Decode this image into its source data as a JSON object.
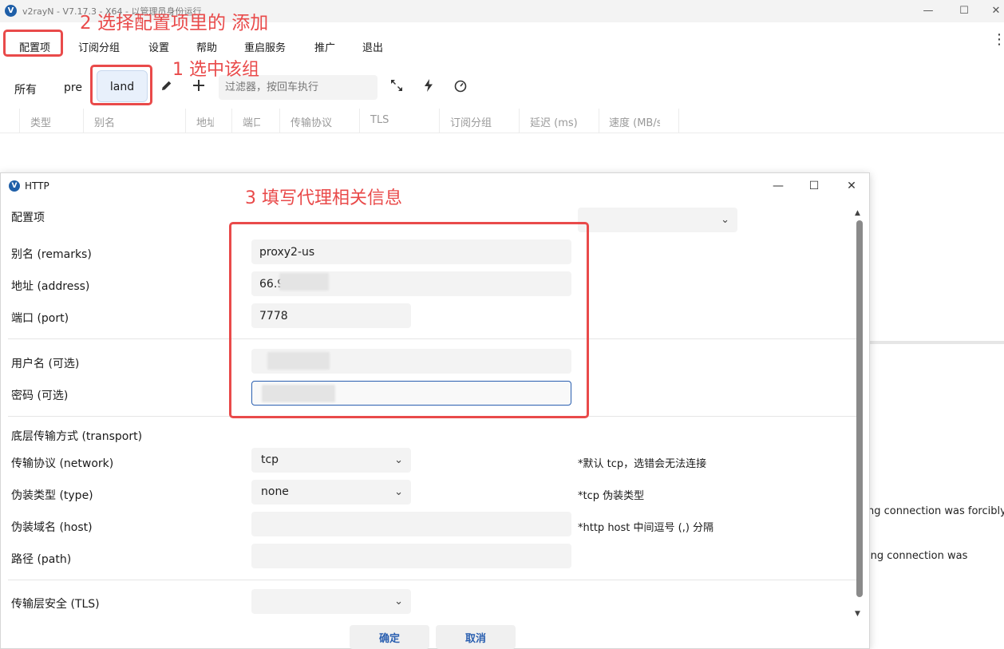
{
  "window": {
    "title": "v2rayN - V7.17.3 - X64 - 以管理员身份运行",
    "controls": {
      "minimize": "—",
      "maximize": "☐",
      "close": "✕"
    }
  },
  "menu": {
    "items": [
      "配置项",
      "订阅分组",
      "设置",
      "帮助",
      "重启服务",
      "推广",
      "退出"
    ],
    "more": "⋮"
  },
  "groups": {
    "tabs": [
      "所有",
      "pre",
      "land"
    ],
    "active": "land",
    "filter_placeholder": "过滤器，按回车执行"
  },
  "columns": [
    "类型",
    "别名",
    "地址",
    "端口",
    "传输协议",
    "TLS",
    "订阅分组",
    "延迟 (ms)",
    "速度 (MB/s)"
  ],
  "log": [
    "ng connection was forcibly",
    "ing connection was"
  ],
  "annotations": {
    "step1": "1 选中该组",
    "step2": "2 选择配置项里的 添加",
    "step3": "3 填写代理相关信息"
  },
  "dialog": {
    "title": "HTTP",
    "fields": {
      "config_label": "配置项",
      "remarks_label": "别名 (remarks)",
      "remarks_value": "proxy2-us",
      "address_label": "地址 (address)",
      "address_value": "66.9",
      "port_label": "端口 (port)",
      "port_value": "7778",
      "username_label": "用户名 (可选)",
      "username_value": "",
      "password_label": "密码 (可选)",
      "password_value": "",
      "transport_label": "底层传输方式 (transport)",
      "network_label": "传输协议 (network)",
      "network_value": "tcp",
      "network_hint": "*默认 tcp，选错会无法连接",
      "type_label": "伪装类型 (type)",
      "type_value": "none",
      "type_hint": "*tcp 伪装类型",
      "host_label": "伪装域名 (host)",
      "host_value": "",
      "host_hint": "*http host 中间逗号 (,) 分隔",
      "path_label": "路径 (path)",
      "path_value": "",
      "tls_label": "传输层安全 (TLS)",
      "tls_value": ""
    },
    "buttons": {
      "confirm": "确定",
      "cancel": "取消"
    }
  },
  "colors": {
    "annotation": "#e94a4a",
    "accent": "#2a5fb0"
  }
}
